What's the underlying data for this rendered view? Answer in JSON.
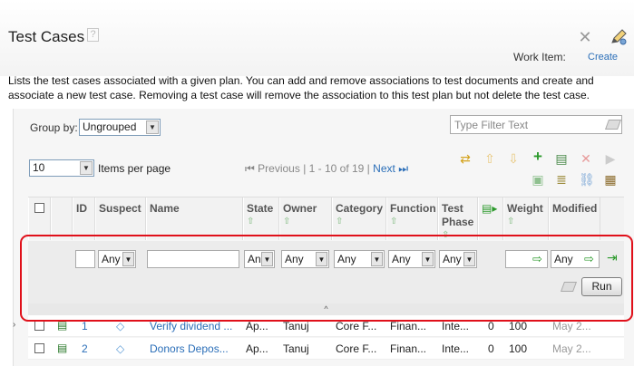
{
  "header": {
    "title": "Test Cases",
    "help_glyph": "?",
    "work_item_label": "Work Item:",
    "create_link": "Create",
    "description": "Lists the test cases associated with a given plan. You can add and remove associations to test documents and create and associate a new test case. Removing a test case will remove the association to this test plan but not delete the test case."
  },
  "controls": {
    "group_by_label": "Group by:",
    "group_by_value": "Ungrouped",
    "filter_placeholder": "Type Filter Text",
    "items_per_page_value": "10",
    "items_per_page_label": "Items per page",
    "pager_previous": "Previous",
    "pager_range": "| 1 - 10 of 19 |",
    "pager_next": "Next"
  },
  "columns": {
    "id": "ID",
    "suspect": "Suspect",
    "name": "Name",
    "state": "State",
    "owner": "Owner",
    "category": "Category",
    "function": "Function",
    "test_phase_1": "Test",
    "test_phase_2": "Phase",
    "weight": "Weight",
    "modified": "Modified"
  },
  "filters": {
    "suspect": "Any",
    "state": "An",
    "owner": "Any",
    "category": "Any",
    "function": "Any",
    "test_phase": "Any",
    "modified": "Any",
    "run_label": "Run",
    "collapse_glyph": "^"
  },
  "rows": [
    {
      "id": "1",
      "name": "Verify dividend ...",
      "state": "Ap...",
      "owner": "Tanuj",
      "category": "Core F...",
      "function": "Finan...",
      "phase": "Inte...",
      "count": "0",
      "weight": "100",
      "modified": "May 2..."
    },
    {
      "id": "2",
      "name": "Donors Depos...",
      "state": "Ap...",
      "owner": "Tanuj",
      "category": "Core F...",
      "function": "Finan...",
      "phase": "Inte...",
      "count": "0",
      "weight": "100",
      "modified": "May 2..."
    }
  ],
  "colors": {
    "link": "#2a6eb8",
    "highlight": "#e0101a",
    "green_icon": "#2c9a2c"
  }
}
